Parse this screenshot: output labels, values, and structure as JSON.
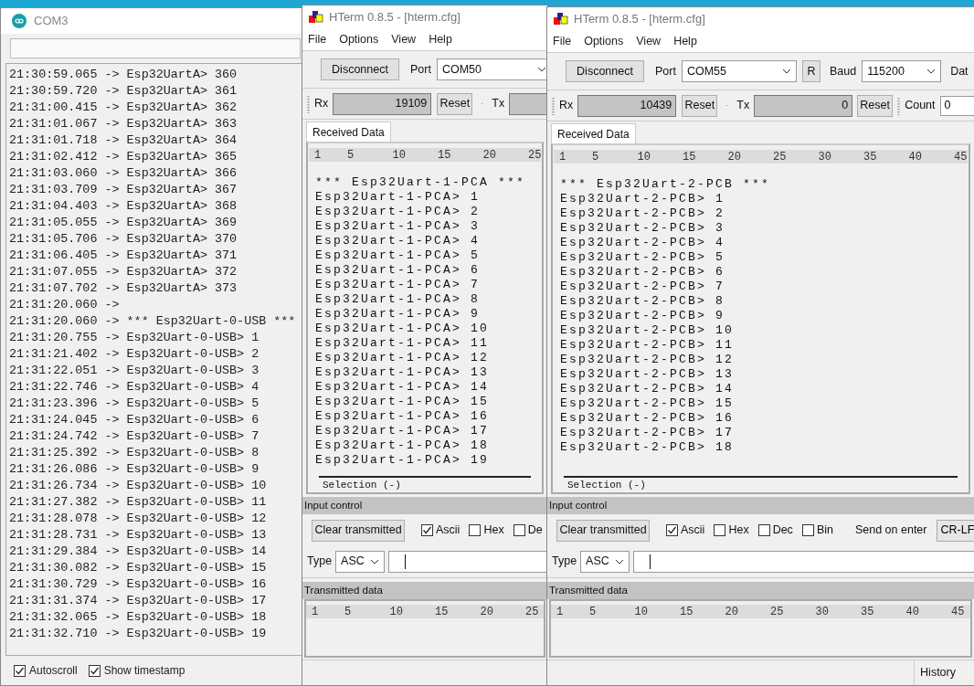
{
  "windows": [
    {
      "kind": "serial_monitor",
      "title": "COM3",
      "log": [
        "21:30:59.065 -> Esp32UartA> 360",
        "21:30:59.720 -> Esp32UartA> 361",
        "21:31:00.415 -> Esp32UartA> 362",
        "21:31:01.067 -> Esp32UartA> 363",
        "21:31:01.718 -> Esp32UartA> 364",
        "21:31:02.412 -> Esp32UartA> 365",
        "21:31:03.060 -> Esp32UartA> 366",
        "21:31:03.709 -> Esp32UartA> 367",
        "21:31:04.403 -> Esp32UartA> 368",
        "21:31:05.055 -> Esp32UartA> 369",
        "21:31:05.706 -> Esp32UartA> 370",
        "21:31:06.405 -> Esp32UartA> 371",
        "21:31:07.055 -> Esp32UartA> 372",
        "21:31:07.702 -> Esp32UartA> 373",
        "21:31:20.060 ->",
        "21:31:20.060 -> *** Esp32Uart-0-USB ***",
        "21:31:20.755 -> Esp32Uart-0-USB> 1",
        "21:31:21.402 -> Esp32Uart-0-USB> 2",
        "21:31:22.051 -> Esp32Uart-0-USB> 3",
        "21:31:22.746 -> Esp32Uart-0-USB> 4",
        "21:31:23.396 -> Esp32Uart-0-USB> 5",
        "21:31:24.045 -> Esp32Uart-0-USB> 6",
        "21:31:24.742 -> Esp32Uart-0-USB> 7",
        "21:31:25.392 -> Esp32Uart-0-USB> 8",
        "21:31:26.086 -> Esp32Uart-0-USB> 9",
        "21:31:26.734 -> Esp32Uart-0-USB> 10",
        "21:31:27.382 -> Esp32Uart-0-USB> 11",
        "21:31:28.078 -> Esp32Uart-0-USB> 12",
        "21:31:28.731 -> Esp32Uart-0-USB> 13",
        "21:31:29.384 -> Esp32Uart-0-USB> 14",
        "21:31:30.082 -> Esp32Uart-0-USB> 15",
        "21:31:30.729 -> Esp32Uart-0-USB> 16",
        "21:31:31.374 -> Esp32Uart-0-USB> 17",
        "21:31:32.065 -> Esp32Uart-0-USB> 18",
        "21:31:32.710 -> Esp32Uart-0-USB> 19"
      ],
      "options": [
        {
          "label": "Autoscroll",
          "checked": true
        },
        {
          "label": "Show timestamp",
          "checked": true
        }
      ]
    },
    {
      "kind": "hterm",
      "title": "HTerm 0.8.5 - [hterm.cfg]",
      "menu": [
        "File",
        "Options",
        "View",
        "Help"
      ],
      "toolbar": {
        "disconnect": "Disconnect",
        "port_label": "Port",
        "port": "COM50"
      },
      "counters": {
        "rx_label": "Rx",
        "rx": "19109",
        "rx_reset": "Reset",
        "tx_label": "Tx"
      },
      "tab": "Received Data",
      "ruler": [
        "1",
        "5",
        "10",
        "15",
        "20",
        "25"
      ],
      "lines": [
        "*** Esp32Uart-1-PCA ***",
        "Esp32Uart-1-PCA> 1",
        "Esp32Uart-1-PCA> 2",
        "Esp32Uart-1-PCA> 3",
        "Esp32Uart-1-PCA> 4",
        "Esp32Uart-1-PCA> 5",
        "Esp32Uart-1-PCA> 6",
        "Esp32Uart-1-PCA> 7",
        "Esp32Uart-1-PCA> 8",
        "Esp32Uart-1-PCA> 9",
        "Esp32Uart-1-PCA> 10",
        "Esp32Uart-1-PCA> 11",
        "Esp32Uart-1-PCA> 12",
        "Esp32Uart-1-PCA> 13",
        "Esp32Uart-1-PCA> 14",
        "Esp32Uart-1-PCA> 15",
        "Esp32Uart-1-PCA> 16",
        "Esp32Uart-1-PCA> 17",
        "Esp32Uart-1-PCA> 18",
        "Esp32Uart-1-PCA> 19"
      ],
      "selection": "Selection (-)",
      "input_control": {
        "title": "Input control",
        "clear": "Clear transmitted",
        "formats": [
          {
            "label": "Ascii",
            "checked": true
          },
          {
            "label": "Hex",
            "checked": false
          },
          {
            "label": "De",
            "checked": false
          }
        ],
        "type_label": "Type",
        "type": "ASC"
      },
      "transmitted": {
        "title": "Transmitted data",
        "ruler": [
          "1",
          "5",
          "10",
          "15",
          "20",
          "25"
        ]
      }
    },
    {
      "kind": "hterm",
      "title": "HTerm 0.8.5 - [hterm.cfg]",
      "menu": [
        "File",
        "Options",
        "View",
        "Help"
      ],
      "toolbar": {
        "disconnect": "Disconnect",
        "port_label": "Port",
        "port": "COM55",
        "refresh": "R",
        "baud_label": "Baud",
        "baud": "115200",
        "data_label": "Dat"
      },
      "counters": {
        "rx_label": "Rx",
        "rx": "10439",
        "rx_reset": "Reset",
        "tx_label": "Tx",
        "tx": "0",
        "tx_reset": "Reset",
        "count_label": "Count",
        "count": "0"
      },
      "tab": "Received Data",
      "ruler": [
        "1",
        "5",
        "10",
        "15",
        "20",
        "25",
        "30",
        "35",
        "40",
        "45"
      ],
      "lines": [
        "*** Esp32Uart-2-PCB ***",
        "Esp32Uart-2-PCB> 1",
        "Esp32Uart-2-PCB> 2",
        "Esp32Uart-2-PCB> 3",
        "Esp32Uart-2-PCB> 4",
        "Esp32Uart-2-PCB> 5",
        "Esp32Uart-2-PCB> 6",
        "Esp32Uart-2-PCB> 7",
        "Esp32Uart-2-PCB> 8",
        "Esp32Uart-2-PCB> 9",
        "Esp32Uart-2-PCB> 10",
        "Esp32Uart-2-PCB> 11",
        "Esp32Uart-2-PCB> 12",
        "Esp32Uart-2-PCB> 13",
        "Esp32Uart-2-PCB> 14",
        "Esp32Uart-2-PCB> 15",
        "Esp32Uart-2-PCB> 16",
        "Esp32Uart-2-PCB> 17",
        "Esp32Uart-2-PCB> 18"
      ],
      "selection": "Selection (-)",
      "input_control": {
        "title": "Input control",
        "clear": "Clear transmitted",
        "formats": [
          {
            "label": "Ascii",
            "checked": true
          },
          {
            "label": "Hex",
            "checked": false
          },
          {
            "label": "Dec",
            "checked": false
          },
          {
            "label": "Bin",
            "checked": false
          }
        ],
        "send_label": "Send on enter",
        "send": "CR-LF",
        "type_label": "Type",
        "type": "ASC"
      },
      "transmitted": {
        "title": "Transmitted data",
        "ruler": [
          "1",
          "5",
          "10",
          "15",
          "20",
          "25",
          "30",
          "35",
          "40",
          "45"
        ]
      },
      "status": "History"
    }
  ]
}
